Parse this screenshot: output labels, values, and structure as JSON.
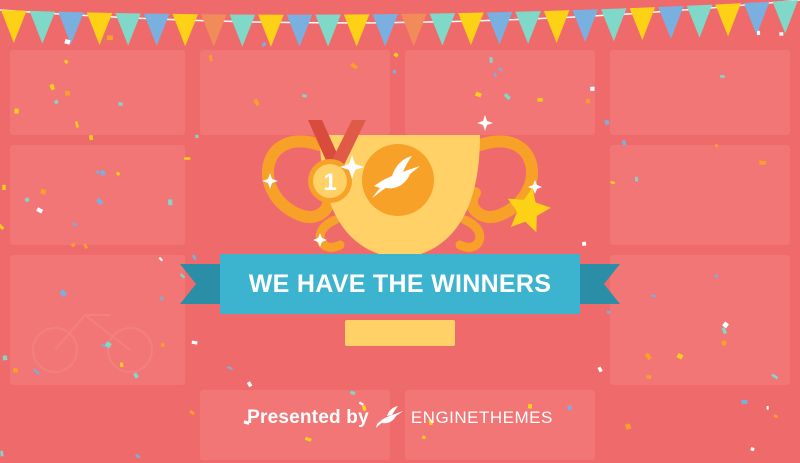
{
  "banner": {
    "headline": "WE HAVE THE WINNERS",
    "ribbon_color": "#3db4cf",
    "ribbon_dark": "#2a8ea6"
  },
  "trophy": {
    "place_label": "1",
    "cup_color": "#ffd166",
    "handle_color": "#f7a128",
    "medal_color": "#f7a128",
    "icon": "hummingbird-icon"
  },
  "footer": {
    "presented_label": "Presented by",
    "brand_name": "ENGINETHEMES",
    "brand_icon": "hummingbird-icon"
  },
  "colors": {
    "background": "#ef6b6b",
    "flag_yellow": "#fcd116",
    "flag_teal": "#7fd8c8",
    "flag_blue": "#7ab0e0",
    "star": "#fcd116"
  }
}
